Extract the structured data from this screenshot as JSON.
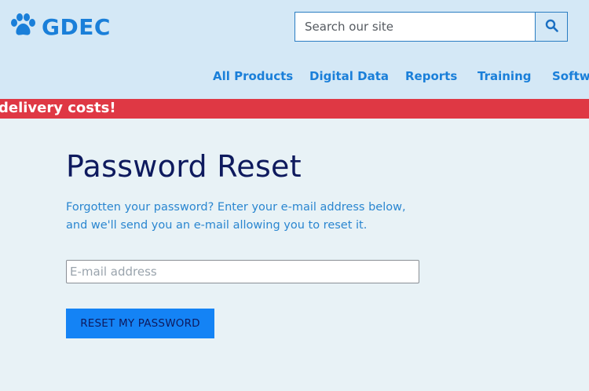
{
  "logo": {
    "text": "GDEC",
    "icon": "paw-icon",
    "color": "#1a7fd9"
  },
  "search": {
    "placeholder": "Search our site",
    "value": "",
    "button_icon": "search-icon"
  },
  "nav": {
    "items": [
      {
        "label": "All Products"
      },
      {
        "label": "Digital Data"
      },
      {
        "label": "Reports"
      },
      {
        "label": "Training"
      },
      {
        "label": "Softwa"
      }
    ]
  },
  "banner": {
    "text": "delivery costs!",
    "color": "#df3844"
  },
  "main": {
    "title": "Password Reset",
    "description_line1": "Forgotten your password? Enter your e-mail address below,",
    "description_line2": "and we'll send you an e-mail allowing you to reset it.",
    "email_placeholder": "E-mail address",
    "email_value": "",
    "reset_label": "RESET MY PASSWORD"
  },
  "colors": {
    "accent": "#1483f5",
    "header_bg": "#d4e8f6",
    "page_bg": "#e8f2f6"
  }
}
